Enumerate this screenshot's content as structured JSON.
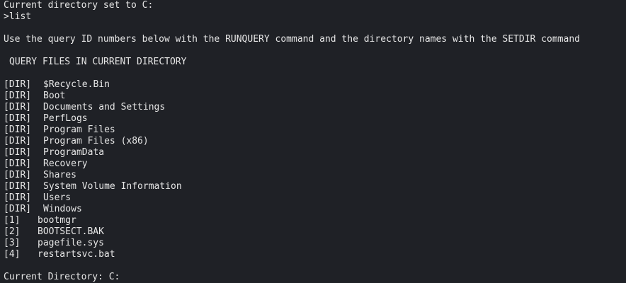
{
  "terminal": {
    "cwd_set_message": "Current directory set to C:",
    "command_line": ">list",
    "usage_hint": "Use the query ID numbers below with the RUNQUERY command and the directory names with the SETDIR command",
    "section_heading": "QUERY FILES IN CURRENT DIRECTORY",
    "directories": [
      {
        "tag": "[DIR]",
        "name": "$Recycle.Bin"
      },
      {
        "tag": "[DIR]",
        "name": "Boot"
      },
      {
        "tag": "[DIR]",
        "name": "Documents and Settings"
      },
      {
        "tag": "[DIR]",
        "name": "PerfLogs"
      },
      {
        "tag": "[DIR]",
        "name": "Program Files"
      },
      {
        "tag": "[DIR]",
        "name": "Program Files (x86)"
      },
      {
        "tag": "[DIR]",
        "name": "ProgramData"
      },
      {
        "tag": "[DIR]",
        "name": "Recovery"
      },
      {
        "tag": "[DIR]",
        "name": "Shares"
      },
      {
        "tag": "[DIR]",
        "name": "System Volume Information"
      },
      {
        "tag": "[DIR]",
        "name": "Users"
      },
      {
        "tag": "[DIR]",
        "name": "Windows"
      }
    ],
    "files": [
      {
        "tag": "[1]",
        "name": "bootmgr"
      },
      {
        "tag": "[2]",
        "name": "BOOTSECT.BAK"
      },
      {
        "tag": "[3]",
        "name": "pagefile.sys"
      },
      {
        "tag": "[4]",
        "name": "restartsvc.bat"
      }
    ],
    "current_directory_line": "Current Directory: C:"
  },
  "colors": {
    "background": "#1f2126",
    "text": "#e6e6e6"
  }
}
